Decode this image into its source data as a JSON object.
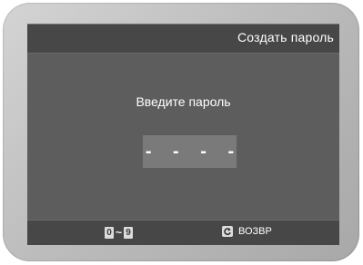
{
  "dialog": {
    "title": "Создать пароль",
    "prompt": "Введите пароль",
    "password_placeholder": "- - - -"
  },
  "footer": {
    "range_start": "0",
    "range_separator": "~",
    "range_end": "9",
    "return_icon": "return-arrow-icon",
    "return_label": "ВОЗВР"
  },
  "colors": {
    "screen_background": "#5d5d5d",
    "bar_background": "#474747",
    "input_background": "#7a7a7a",
    "text": "#ffffff"
  }
}
